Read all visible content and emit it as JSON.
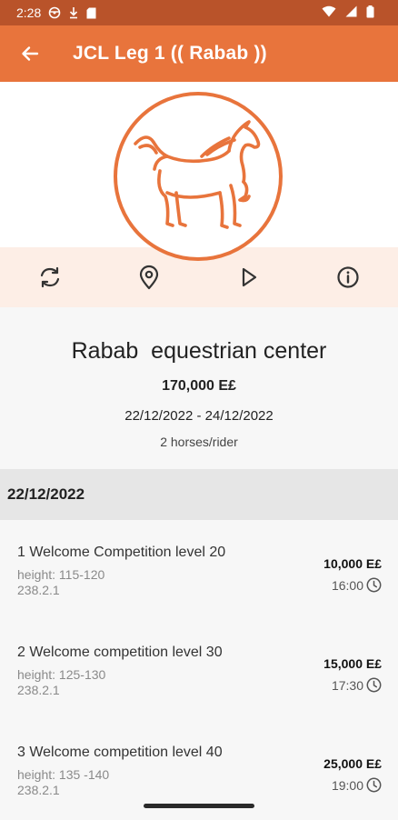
{
  "status_bar": {
    "time": "2:28"
  },
  "app_bar": {
    "title": "JCL Leg 1 (( Rabab ))"
  },
  "colors": {
    "accent": "#e8743c",
    "status_bar": "#b9532a",
    "action_bg": "#fdeee6"
  },
  "actions": [
    {
      "name": "refresh-icon"
    },
    {
      "name": "location-pin-icon"
    },
    {
      "name": "play-icon"
    },
    {
      "name": "info-icon"
    }
  ],
  "event": {
    "venue": "Rabab  equestrian center",
    "price": "170,000 E£",
    "dates": "22/12/2022 - 24/12/2022",
    "horses_per_rider": "2 horses/rider"
  },
  "day": {
    "date": "22/12/2022",
    "competitions": [
      {
        "name": "1 Welcome Competition level 20",
        "height": "height: 115-120",
        "code": "238.2.1",
        "price": "10,000 E£",
        "time": "16:00"
      },
      {
        "name": "2 Welcome competition level 30",
        "height": "height: 125-130",
        "code": "238.2.1",
        "price": "15,000 E£",
        "time": "17:30"
      },
      {
        "name": "3 Welcome competition level 40",
        "height": "height: 135 -140",
        "code": "238.2.1",
        "price": "25,000 E£",
        "time": "19:00"
      }
    ]
  }
}
